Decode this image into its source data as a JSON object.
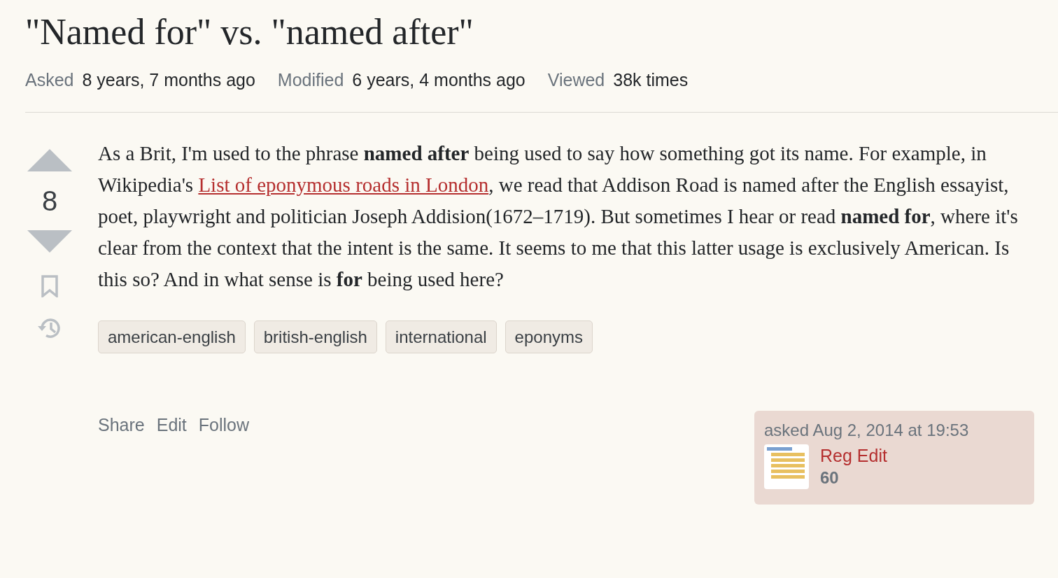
{
  "question": {
    "title": "\"Named for\" vs. \"named after\"",
    "meta": [
      {
        "label": "Asked",
        "value": "8 years, 7 months ago"
      },
      {
        "label": "Modified",
        "value": "6 years, 4 months ago"
      },
      {
        "label": "Viewed",
        "value": "38k times"
      }
    ],
    "score": "8",
    "body_before": "As a Brit, I'm used to the phrase **named after** being used to say how something got its name. For example, in Wikipedia's ",
    "link": "List of eponymous roads in London",
    "body_after": ", we read that Addison Road is named after the English essayist, poet, playwright and politician Joseph Addision(1672–1719). But sometimes I hear or read **named for**, where it's clear from the context that the intent is the same. It seems to me that this latter usage is exclusively American. Is this so? And in what sense is **for** being used here?",
    "tags": [
      "american-english",
      "british-english",
      "international",
      "eponyms"
    ],
    "actions": [
      "Share",
      "Edit",
      "Follow"
    ],
    "asked_time": "asked Aug 2, 2014 at 19:53",
    "user": {
      "name": "Reg Edit",
      "reputation": "60"
    }
  }
}
